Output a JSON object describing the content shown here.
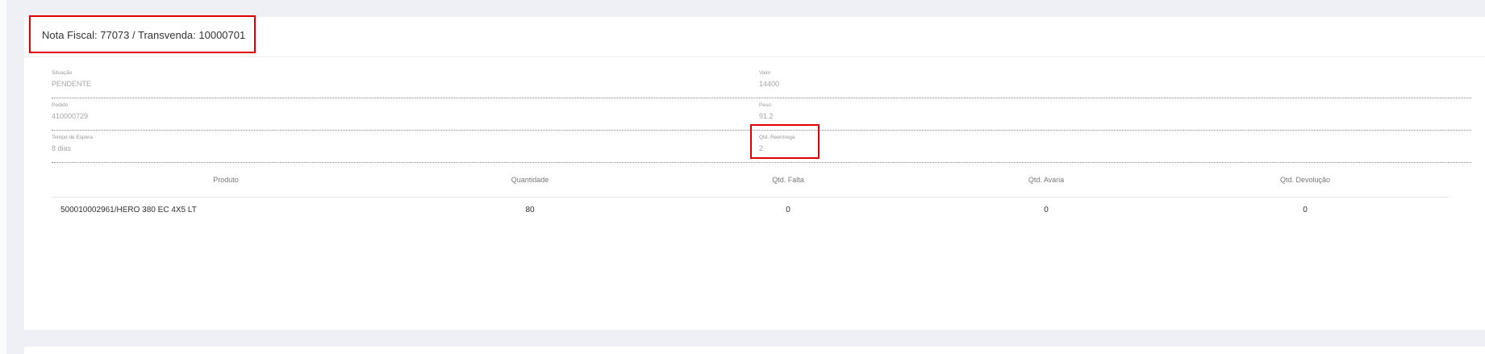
{
  "card": {
    "title": "Nota Fiscal: 77073 / Transvenda: 10000701"
  },
  "fields": {
    "situacao": {
      "label": "Situação",
      "value": "PENDENTE"
    },
    "valor": {
      "label": "Valor",
      "value": "14400"
    },
    "pedido": {
      "label": "Pedido",
      "value": "410000729"
    },
    "peso": {
      "label": "Peso",
      "value": "91.2"
    },
    "tempo_espera": {
      "label": "Tempo de Espera",
      "value": "8 dias"
    },
    "qtd_reentrega": {
      "label": "Qtd. Reentrega",
      "value": "2"
    }
  },
  "table": {
    "columns": [
      "Produto",
      "Quantidade",
      "Qtd. Falta",
      "Qtd. Avaria",
      "Qtd. Devolução"
    ],
    "rows": [
      [
        "500010002961/HERO 380 EC 4X5 LT",
        "80",
        "0",
        "0",
        "0"
      ]
    ]
  }
}
